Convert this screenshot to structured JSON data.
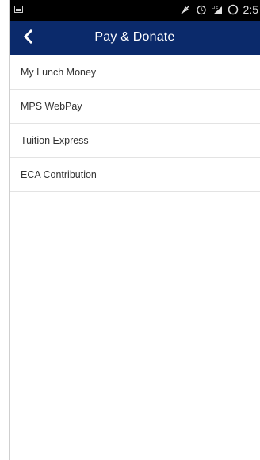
{
  "status_bar": {
    "time": "2:5"
  },
  "header": {
    "title": "Pay & Donate"
  },
  "menu": {
    "items": [
      {
        "label": "My Lunch Money"
      },
      {
        "label": "MPS WebPay"
      },
      {
        "label": "Tuition Express"
      },
      {
        "label": "ECA Contribution"
      }
    ]
  },
  "colors": {
    "toolbar": "#0b2a6b",
    "status_bar": "#000000",
    "divider": "#e3e3e3"
  }
}
